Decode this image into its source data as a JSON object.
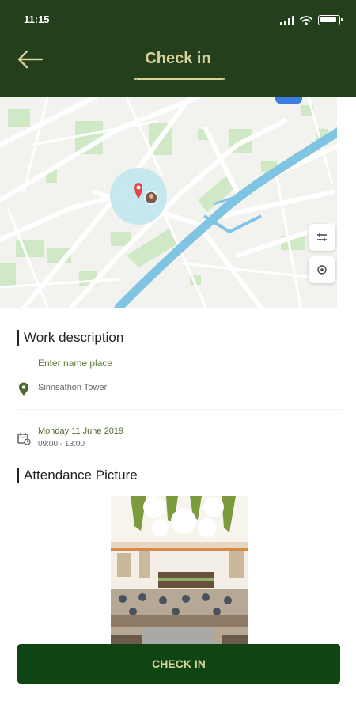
{
  "status_bar": {
    "time": "11:15"
  },
  "header": {
    "title": "Check in"
  },
  "work": {
    "section_title": "Work description",
    "name_placeholder": "Enter name place",
    "location_name": "Sinnsathon Tower"
  },
  "schedule": {
    "date": "Monday 11 June 2019",
    "time_range": "09:00 - 13:00"
  },
  "attendance": {
    "section_title": "Attendance Picture"
  },
  "actions": {
    "check_in_label": "CHECK IN"
  },
  "colors": {
    "header_bg": "#233f1c",
    "accent_gold": "#d9d29a",
    "button_bg": "#0f4413",
    "river_blue": "#7fc5e3",
    "park_green": "#cfe9c6",
    "pin_red": "#e04848"
  },
  "icons": {
    "back": "arrow-left-icon",
    "filter": "sliders-icon",
    "locate": "target-icon",
    "location": "map-pin-icon",
    "calendar": "calendar-icon"
  }
}
